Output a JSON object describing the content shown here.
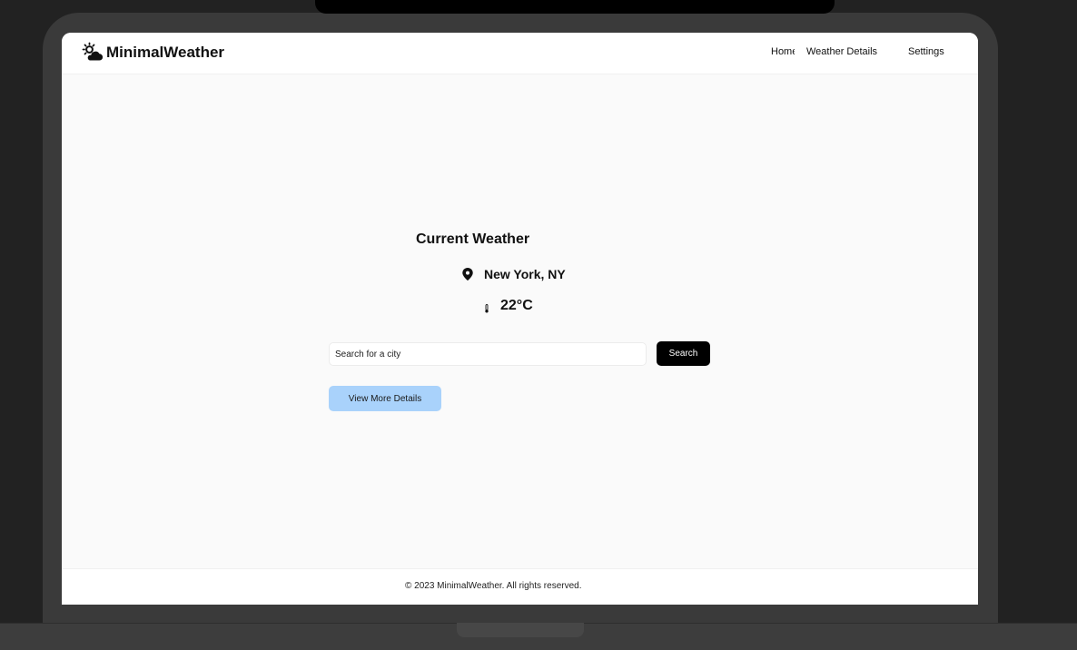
{
  "colors": {
    "accent_button": "#000000",
    "details_button": "#a9d2fb",
    "page_background": "#fafafa"
  },
  "header": {
    "brand_icon": "sun-cloud-icon",
    "brand_name": "MinimalWeather",
    "nav": {
      "home": "Home",
      "weather_details": "Weather Details",
      "settings": "Settings"
    }
  },
  "main": {
    "title": "Current Weather",
    "location_icon": "map-pin-icon",
    "location": "New York, NY",
    "temperature_icon": "thermometer-icon",
    "temperature": "22°C",
    "search": {
      "placeholder": "Search for a city",
      "value": "",
      "button_label": "Search"
    },
    "details_button_label": "View More Details"
  },
  "footer": {
    "text": "© 2023 MinimalWeather. All rights reserved."
  }
}
